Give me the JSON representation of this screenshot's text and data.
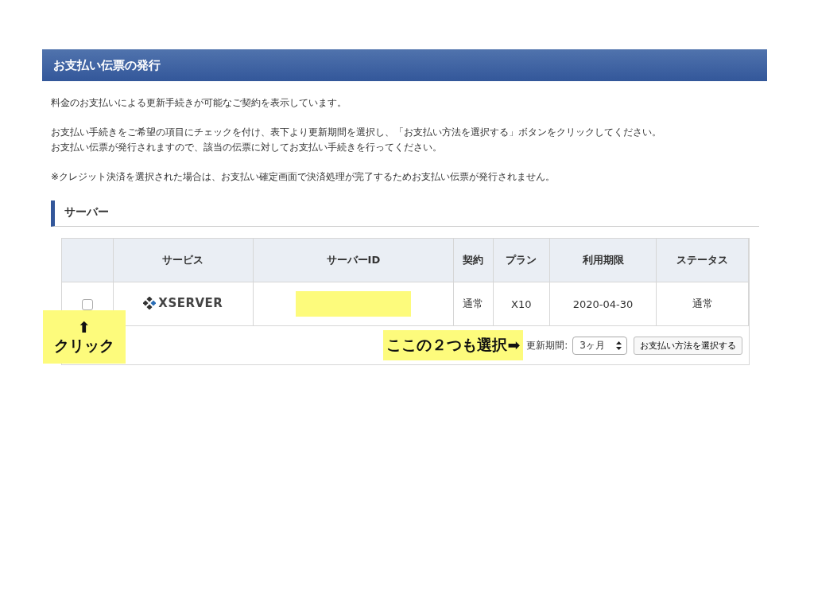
{
  "header": {
    "title": "お支払い伝票の発行"
  },
  "paragraphs": [
    [
      "料金のお支払いによる更新手続きが可能なご契約を表示しています。"
    ],
    [
      "お支払い手続きをご希望の項目にチェックを付け、表下より更新期間を選択し、「お支払い方法を選択する」ボタンをクリックしてください。",
      "お支払い伝票が発行されますので、該当の伝票に対してお支払い手続きを行ってください。"
    ],
    [
      "※クレジット決済を選択された場合は、お支払い確定画面で決済処理が完了するためお支払い伝票が発行されません。"
    ]
  ],
  "section": {
    "title": "サーバー"
  },
  "table": {
    "columns": [
      "サービス",
      "サーバーID",
      "契約",
      "プラン",
      "利用期限",
      "ステータス"
    ],
    "rows": [
      {
        "checked": false,
        "service": "XSERVER",
        "contract": "通常",
        "plan": "X10",
        "expiry": "2020-04-30",
        "status": "通常"
      }
    ]
  },
  "footer": {
    "period_label": "更新期間:",
    "period_value": "3ヶ月",
    "button": "お支払い方法を選択する"
  },
  "annotations": [
    {
      "kind": "up",
      "arrow": "⬆",
      "text": "クリック"
    },
    {
      "kind": "right",
      "text": "ここの２つも選択",
      "arrow": "➡"
    }
  ]
}
